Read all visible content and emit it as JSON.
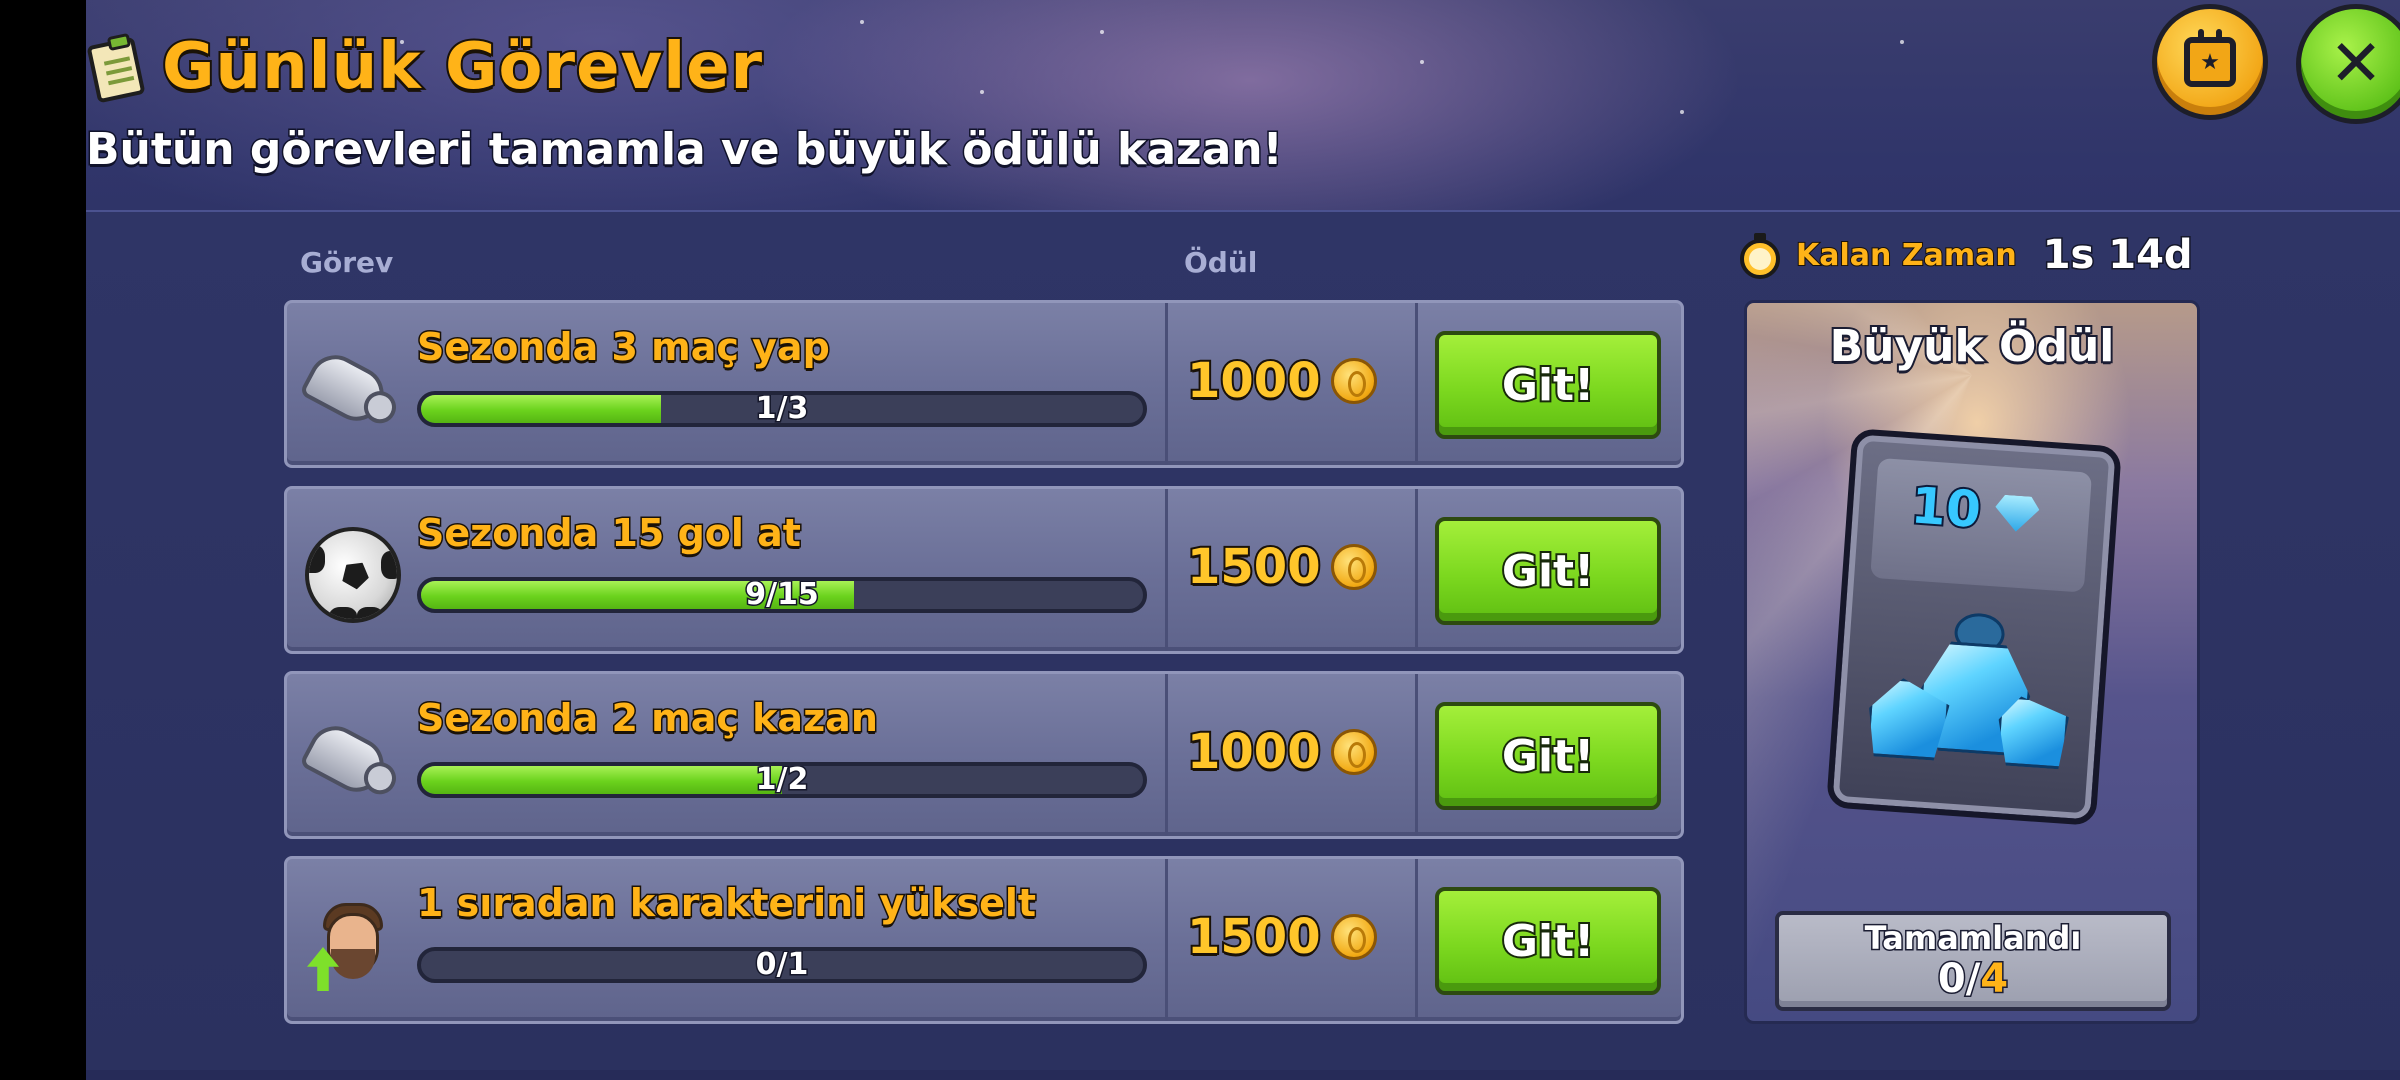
{
  "header": {
    "title": "Günlük Görevler",
    "subtitle": "Bütün görevleri tamamla ve büyük ödülü kazan!"
  },
  "columns": {
    "task": "Görev",
    "reward": "Ödül"
  },
  "timer": {
    "label": "Kalan Zaman",
    "value": "1s 14d"
  },
  "tasks": [
    {
      "icon": "whistle-icon",
      "title": "Sezonda 3 maç yap",
      "progress_text": "1/3",
      "progress": 0.333,
      "reward": "1000",
      "button": "Git!"
    },
    {
      "icon": "soccer-ball-icon",
      "title": "Sezonda 15 gol at",
      "progress_text": "9/15",
      "progress": 0.6,
      "reward": "1500",
      "button": "Git!"
    },
    {
      "icon": "whistle-icon",
      "title": "Sezonda 2 maç kazan",
      "progress_text": "1/2",
      "progress": 0.5,
      "reward": "1000",
      "button": "Git!"
    },
    {
      "icon": "character-upgrade-icon",
      "title": "1 sıradan karakterini yükselt",
      "progress_text": "0/1",
      "progress": 0,
      "reward": "1500",
      "button": "Git!"
    }
  ],
  "grand_prize": {
    "title": "Büyük Ödül",
    "quantity": "10",
    "item_icon": "diamond-icon",
    "completed_label": "Tamamlandı",
    "completed_count": "0",
    "completed_separator": "/",
    "completed_total": "4"
  },
  "colors": {
    "accent_orange": "#ffb318",
    "button_green": "#7cd81f",
    "panel_blue": "#2b315f",
    "gem_blue": "#37c8ff"
  }
}
